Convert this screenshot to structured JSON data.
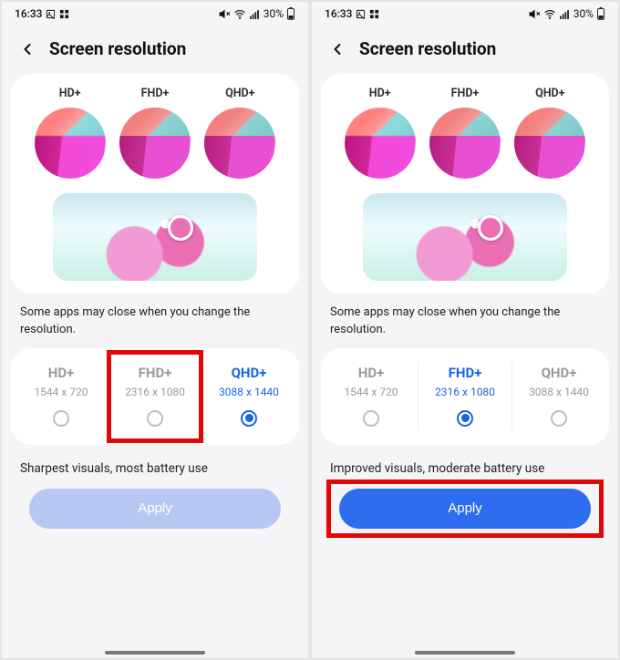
{
  "statusbar": {
    "time": "16:33",
    "battery_pct": "30%"
  },
  "header": {
    "title": "Screen resolution"
  },
  "thumbs": {
    "hd": "HD+",
    "fhd": "FHD+",
    "qhd": "QHD+"
  },
  "note": "Some apps may close when you change the resolution.",
  "options": {
    "hd": {
      "title": "HD+",
      "sub": "1544 x 720"
    },
    "fhd": {
      "title": "FHD+",
      "sub": "2316 x 1080"
    },
    "qhd": {
      "title": "QHD+",
      "sub": "3088 x 1440"
    }
  },
  "screens": {
    "left": {
      "selected": "qhd",
      "highlight": "fhd",
      "desc": "Sharpest visuals, most battery use",
      "apply_label": "Apply",
      "apply_enabled": false,
      "apply_highlight": false
    },
    "right": {
      "selected": "fhd",
      "highlight": null,
      "desc": "Improved visuals, moderate battery use",
      "apply_label": "Apply",
      "apply_enabled": true,
      "apply_highlight": true
    }
  }
}
